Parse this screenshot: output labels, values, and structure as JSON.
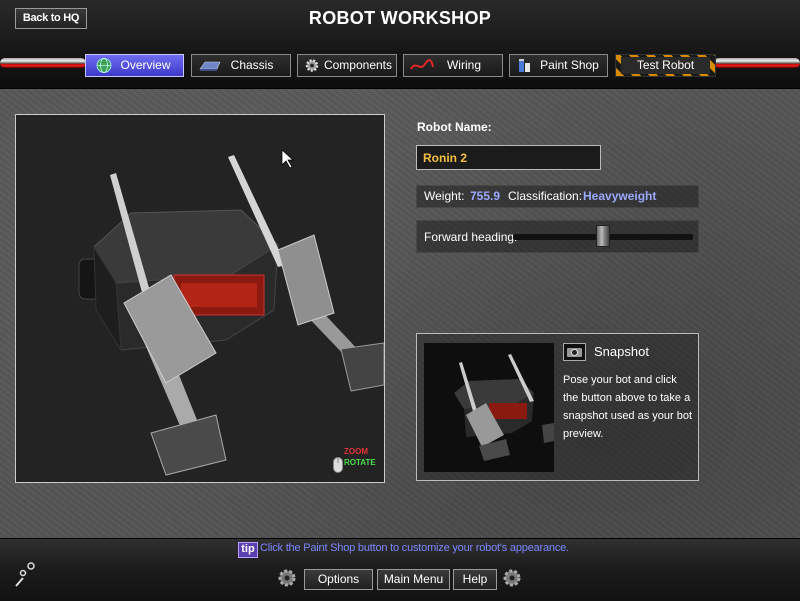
{
  "header": {
    "back_label": "Back to HQ",
    "title": "ROBOT WORKSHOP",
    "tabs": [
      {
        "label": "Overview",
        "icon": "globe-icon",
        "active": true
      },
      {
        "label": "Chassis",
        "icon": "chassis-icon"
      },
      {
        "label": "Components",
        "icon": "gear-icon"
      },
      {
        "label": "Wiring",
        "icon": "wire-icon"
      },
      {
        "label": "Paint Shop",
        "icon": "paint-cans-icon"
      },
      {
        "label": "Test Robot",
        "icon": "hazard-stripes"
      }
    ]
  },
  "viewport": {
    "zoom_label": "ZOOM",
    "rotate_label": "ROTATE",
    "mouse_icon": "mouse-icon"
  },
  "robot": {
    "name_label": "Robot Name:",
    "name": "Ronin 2",
    "weight_label": "Weight:",
    "weight": "755.9",
    "class_label": "Classification:",
    "classification": "Heavyweight",
    "heading_label": "Forward heading:",
    "heading_fraction": 0.5
  },
  "snapshot": {
    "title": "Snapshot",
    "description": "Pose your bot and click the button above to take a snapshot used as your bot preview.",
    "camera_icon": "camera-icon"
  },
  "footer": {
    "tip_badge": "tip",
    "tip_text": "Click the Paint Shop button to customize your robot's appearance.",
    "options_label": "Options",
    "main_menu_label": "Main Menu",
    "help_label": "Help"
  },
  "colors": {
    "accent": "#4f4ce0",
    "name_text": "#f5c040",
    "value_text": "#9aa8ff",
    "tip_text": "#7b88ff"
  }
}
